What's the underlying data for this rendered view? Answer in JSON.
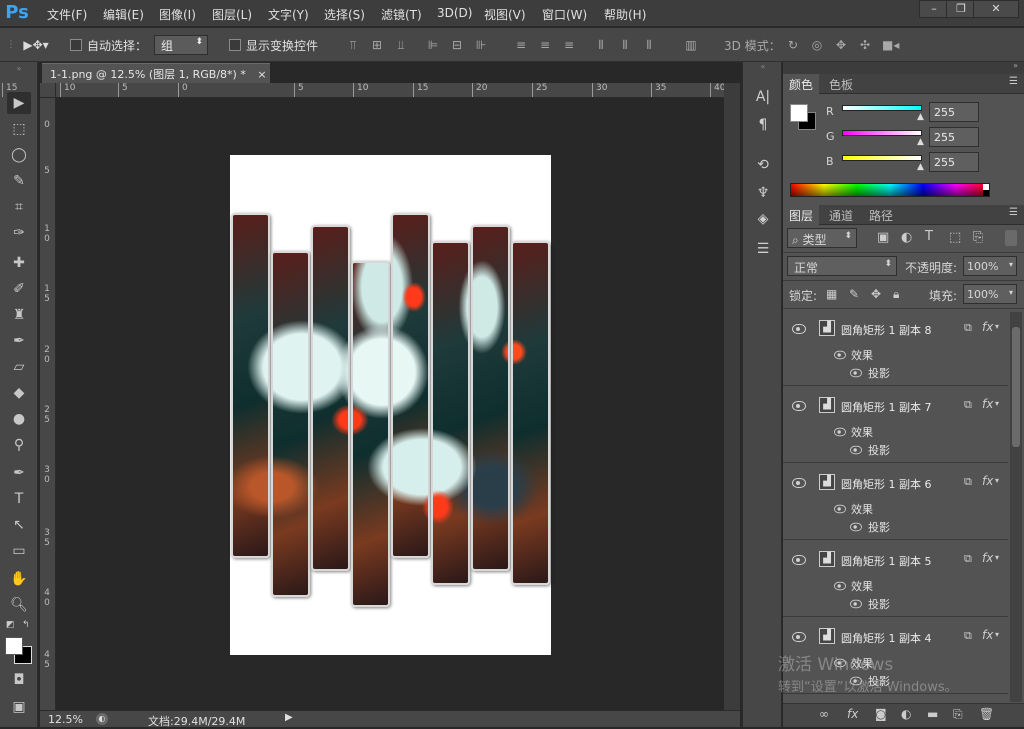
{
  "app": {
    "logo": "Ps"
  },
  "menu": [
    "文件(F)",
    "编辑(E)",
    "图像(I)",
    "图层(L)",
    "文字(Y)",
    "选择(S)",
    "滤镜(T)",
    "3D(D)",
    "视图(V)",
    "窗口(W)",
    "帮助(H)"
  ],
  "window_controls": [
    "minimize",
    "restore",
    "close"
  ],
  "options": {
    "auto_select_label": "自动选择：",
    "auto_select_value": "组",
    "show_transform_label": "显示变换控件",
    "mode_3d_label": "3D 模式："
  },
  "document": {
    "tab_title": "1-1.png @ 12.5% (图层 1, RGB/8*) *",
    "close_glyph": "×"
  },
  "ruler_top_labels": [
    "15",
    "10",
    "5",
    "0",
    "5",
    "10",
    "15",
    "20",
    "25",
    "30",
    "35",
    "40"
  ],
  "ruler_left_labels": [
    "0",
    "5",
    "1 0",
    "1 5",
    "2 0",
    "2 5",
    "3 0",
    "3 5",
    "4 0",
    "4 5"
  ],
  "status": {
    "zoom": "12.5%",
    "doc_size": "文档:29.4M/29.4M"
  },
  "color_panel": {
    "tabs": [
      "颜色",
      "色板"
    ],
    "channels": [
      {
        "label": "R",
        "value": "255",
        "color": "#00ffff"
      },
      {
        "label": "G",
        "value": "255",
        "color": "#ff00ff"
      },
      {
        "label": "B",
        "value": "255",
        "color": "#ffff00"
      }
    ]
  },
  "layers_panel": {
    "tabs": [
      "图层",
      "通道",
      "路径"
    ],
    "filter_label": "类型",
    "blend_mode": "正常",
    "opacity_label": "不透明度:",
    "opacity_value": "100%",
    "lock_label": "锁定:",
    "fill_label": "填充:",
    "fill_value": "100%",
    "layers": [
      {
        "name": "圆角矩形 1 副本 8",
        "effects_label": "效果",
        "effect": "投影"
      },
      {
        "name": "圆角矩形 1 副本 7",
        "effects_label": "效果",
        "effect": "投影"
      },
      {
        "name": "圆角矩形 1 副本 6",
        "effects_label": "效果",
        "effect": "投影"
      },
      {
        "name": "圆角矩形 1 副本 5",
        "effects_label": "效果",
        "effect": "投影"
      },
      {
        "name": "圆角矩形 1 副本 4",
        "effects_label": "效果",
        "effect": "投影"
      }
    ]
  },
  "watermark": {
    "line1": "激活 Windows",
    "line2": "转到“设置”以激活 Windows。"
  }
}
